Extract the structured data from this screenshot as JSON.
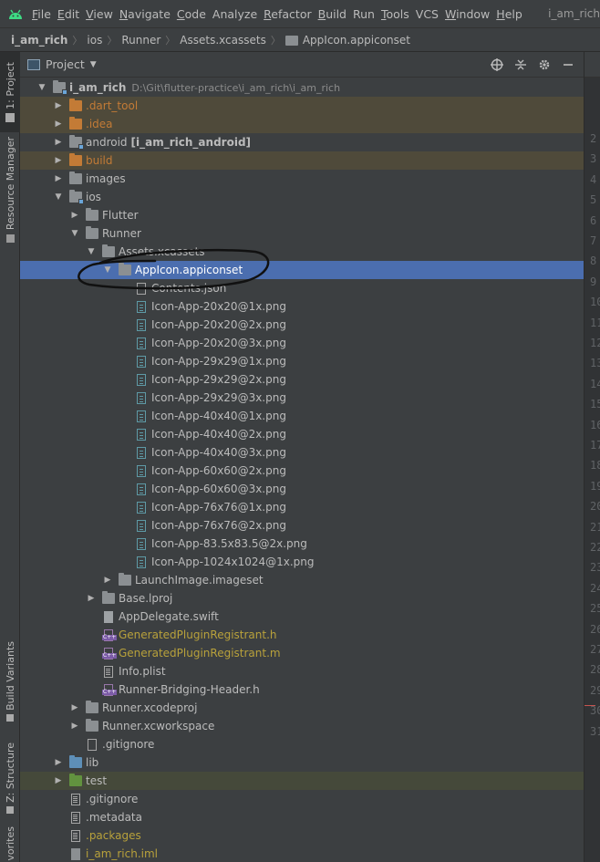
{
  "menubar": {
    "items": [
      {
        "label": "File",
        "mnemonic": "F",
        "rest": "ile"
      },
      {
        "label": "Edit",
        "mnemonic": "E",
        "rest": "dit"
      },
      {
        "label": "View",
        "mnemonic": "V",
        "rest": "iew"
      },
      {
        "label": "Navigate",
        "mnemonic": "N",
        "rest": "avigate"
      },
      {
        "label": "Code",
        "mnemonic": "C",
        "rest": "ode"
      },
      {
        "label": "Analyze",
        "mnemonic": "",
        "rest": "Analyze"
      },
      {
        "label": "Refactor",
        "mnemonic": "R",
        "rest": "efactor"
      },
      {
        "label": "Build",
        "mnemonic": "B",
        "rest": "uild"
      },
      {
        "label": "Run",
        "mnemonic": "",
        "rest": "Run"
      },
      {
        "label": "Tools",
        "mnemonic": "T",
        "rest": "ools"
      },
      {
        "label": "VCS",
        "mnemonic": "",
        "rest": "VCS"
      },
      {
        "label": "Window",
        "mnemonic": "W",
        "rest": "indow"
      },
      {
        "label": "Help",
        "mnemonic": "H",
        "rest": "elp"
      }
    ],
    "window_title": "i_am_rich"
  },
  "breadcrumb": {
    "items": [
      "i_am_rich",
      "ios",
      "Runner",
      "Assets.xcassets",
      "AppIcon.appiconset"
    ]
  },
  "stripe": {
    "project_tab": "1: Project",
    "resource_manager_tab": "Resource Manager",
    "build_variants_tab": "Build Variants",
    "structure_tab": "Z: Structure",
    "favorites_tab": "vorites"
  },
  "panel": {
    "title": "Project",
    "tools": [
      "globe-icon",
      "collapse-icon",
      "gear-icon",
      "minimize-icon"
    ]
  },
  "tree": [
    {
      "label": "i_am_rich",
      "sub": "D:\\Git\\flutter-practice\\i_am_rich\\i_am_rich",
      "depth": 0,
      "arrow": "down",
      "icon": "folder-module",
      "style": "bold"
    },
    {
      "label": ".dart_tool",
      "depth": 1,
      "arrow": "right",
      "icon": "folder-orange",
      "style": "orange",
      "bg": "exclude"
    },
    {
      "label": ".idea",
      "depth": 1,
      "arrow": "right",
      "icon": "folder-orange",
      "style": "orange",
      "bg": "exclude"
    },
    {
      "label": "android",
      "sub_bold": "[i_am_rich_android]",
      "depth": 1,
      "arrow": "right",
      "icon": "folder-module",
      "style": ""
    },
    {
      "label": "build",
      "depth": 1,
      "arrow": "right",
      "icon": "folder-orange",
      "style": "orange",
      "bg": "exclude"
    },
    {
      "label": "images",
      "depth": 1,
      "arrow": "right",
      "icon": "folder",
      "style": ""
    },
    {
      "label": "ios",
      "depth": 1,
      "arrow": "down",
      "icon": "folder-module",
      "style": ""
    },
    {
      "label": "Flutter",
      "depth": 2,
      "arrow": "right",
      "icon": "folder",
      "style": ""
    },
    {
      "label": "Runner",
      "depth": 2,
      "arrow": "down",
      "icon": "folder",
      "style": ""
    },
    {
      "label": "Assets.xcassets",
      "depth": 3,
      "arrow": "down",
      "icon": "folder",
      "style": ""
    },
    {
      "label": "AppIcon.appiconset",
      "depth": 4,
      "arrow": "down",
      "icon": "folder",
      "style": "selected",
      "bg": "selected"
    },
    {
      "label": "Contents.json",
      "depth": 5,
      "arrow": "leaf",
      "icon": "file-json",
      "style": ""
    },
    {
      "label": "Icon-App-20x20@1x.png",
      "depth": 5,
      "arrow": "leaf",
      "icon": "file-img",
      "style": ""
    },
    {
      "label": "Icon-App-20x20@2x.png",
      "depth": 5,
      "arrow": "leaf",
      "icon": "file-img",
      "style": ""
    },
    {
      "label": "Icon-App-20x20@3x.png",
      "depth": 5,
      "arrow": "leaf",
      "icon": "file-img",
      "style": ""
    },
    {
      "label": "Icon-App-29x29@1x.png",
      "depth": 5,
      "arrow": "leaf",
      "icon": "file-img",
      "style": ""
    },
    {
      "label": "Icon-App-29x29@2x.png",
      "depth": 5,
      "arrow": "leaf",
      "icon": "file-img",
      "style": ""
    },
    {
      "label": "Icon-App-29x29@3x.png",
      "depth": 5,
      "arrow": "leaf",
      "icon": "file-img",
      "style": ""
    },
    {
      "label": "Icon-App-40x40@1x.png",
      "depth": 5,
      "arrow": "leaf",
      "icon": "file-img",
      "style": ""
    },
    {
      "label": "Icon-App-40x40@2x.png",
      "depth": 5,
      "arrow": "leaf",
      "icon": "file-img",
      "style": ""
    },
    {
      "label": "Icon-App-40x40@3x.png",
      "depth": 5,
      "arrow": "leaf",
      "icon": "file-img",
      "style": ""
    },
    {
      "label": "Icon-App-60x60@2x.png",
      "depth": 5,
      "arrow": "leaf",
      "icon": "file-img",
      "style": ""
    },
    {
      "label": "Icon-App-60x60@3x.png",
      "depth": 5,
      "arrow": "leaf",
      "icon": "file-img",
      "style": ""
    },
    {
      "label": "Icon-App-76x76@1x.png",
      "depth": 5,
      "arrow": "leaf",
      "icon": "file-img",
      "style": ""
    },
    {
      "label": "Icon-App-76x76@2x.png",
      "depth": 5,
      "arrow": "leaf",
      "icon": "file-img",
      "style": ""
    },
    {
      "label": "Icon-App-83.5x83.5@2x.png",
      "depth": 5,
      "arrow": "leaf",
      "icon": "file-img",
      "style": ""
    },
    {
      "label": "Icon-App-1024x1024@1x.png",
      "depth": 5,
      "arrow": "leaf",
      "icon": "file-img",
      "style": ""
    },
    {
      "label": "LaunchImage.imageset",
      "depth": 4,
      "arrow": "right",
      "icon": "folder",
      "style": ""
    },
    {
      "label": "Base.lproj",
      "depth": 3,
      "arrow": "right",
      "icon": "folder",
      "style": ""
    },
    {
      "label": "AppDelegate.swift",
      "depth": 3,
      "arrow": "leaf",
      "icon": "file-swift",
      "style": ""
    },
    {
      "label": "GeneratedPluginRegistrant.h",
      "depth": 3,
      "arrow": "leaf",
      "icon": "file-cpp",
      "style": "olive"
    },
    {
      "label": "GeneratedPluginRegistrant.m",
      "depth": 3,
      "arrow": "leaf",
      "icon": "file-cpp",
      "style": "olive"
    },
    {
      "label": "Info.plist",
      "depth": 3,
      "arrow": "leaf",
      "icon": "file-text",
      "style": ""
    },
    {
      "label": "Runner-Bridging-Header.h",
      "depth": 3,
      "arrow": "leaf",
      "icon": "file-cpp",
      "style": ""
    },
    {
      "label": "Runner.xcodeproj",
      "depth": 2,
      "arrow": "right",
      "icon": "folder",
      "style": ""
    },
    {
      "label": "Runner.xcworkspace",
      "depth": 2,
      "arrow": "right",
      "icon": "folder",
      "style": ""
    },
    {
      "label": ".gitignore",
      "depth": 2,
      "arrow": "leaf",
      "icon": "file-git",
      "style": ""
    },
    {
      "label": "lib",
      "depth": 1,
      "arrow": "right",
      "icon": "folder-blue",
      "style": ""
    },
    {
      "label": "test",
      "depth": 1,
      "arrow": "right",
      "icon": "folder-green",
      "style": "",
      "bg": "test"
    },
    {
      "label": ".gitignore",
      "depth": 1,
      "arrow": "leaf",
      "icon": "file-text",
      "style": ""
    },
    {
      "label": ".metadata",
      "depth": 1,
      "arrow": "leaf",
      "icon": "file-text",
      "style": ""
    },
    {
      "label": ".packages",
      "depth": 1,
      "arrow": "leaf",
      "icon": "file-text",
      "style": "olive"
    },
    {
      "label": "i_am_rich.iml",
      "depth": 1,
      "arrow": "leaf",
      "icon": "file-iml",
      "style": "olive"
    }
  ],
  "gutter": {
    "line_numbers": [
      "2",
      "3",
      "4",
      "5",
      "6",
      "7",
      "8",
      "9",
      "10",
      "11",
      "12",
      "13",
      "14",
      "15",
      "16",
      "17",
      "18",
      "19",
      "20",
      "21",
      "22",
      "23",
      "24",
      "25",
      "26",
      "27",
      "28",
      "29",
      "30",
      "31"
    ]
  }
}
